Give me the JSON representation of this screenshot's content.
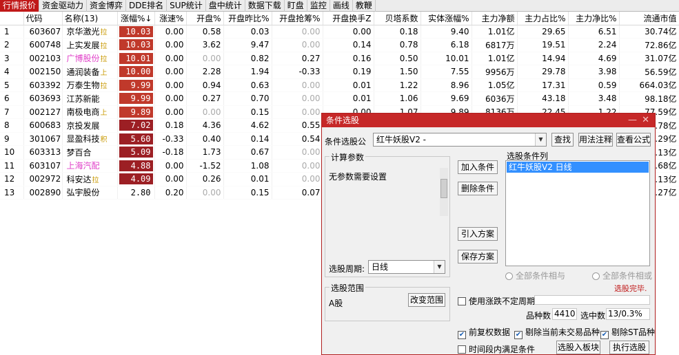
{
  "tabs": [
    "行情报价",
    "资金驱动力",
    "资金博弈",
    "DDE排名",
    "SUP统计",
    "盘中统计",
    "数据下载",
    "盯盘",
    "监控",
    "画线",
    "教鞭"
  ],
  "table": {
    "columns": [
      "",
      "代码",
      "名称(13)",
      "涨幅%↓",
      "涨速%",
      "开盘%",
      "开盘昨比%",
      "开盘抢筹%",
      "开盘换手Z",
      "贝塔系数",
      "实体涨幅%",
      "主力净额",
      "主力占比%",
      "主力净比%",
      "流通市值"
    ],
    "rows": [
      {
        "idx": "1",
        "code": "603607",
        "name": "京华激光",
        "tag": "拉",
        "pct": "10.03",
        "speed": "0.00",
        "open": "0.58",
        "open_prev": "0.03",
        "grab": "0.00",
        "turn": "0.00",
        "beta": "0.18",
        "body": "9.40",
        "net": "1.01亿",
        "occupy": "29.65",
        "netratio": "6.51",
        "cap": "30.74亿"
      },
      {
        "idx": "2",
        "code": "600748",
        "name": "上实发展",
        "tag": "拉",
        "pct": "10.03",
        "speed": "0.00",
        "open": "3.62",
        "open_prev": "9.47",
        "grab": "0.00",
        "turn": "0.14",
        "beta": "0.78",
        "body": "6.18",
        "net": "6817万",
        "occupy": "19.51",
        "netratio": "2.24",
        "cap": "72.86亿"
      },
      {
        "idx": "3",
        "code": "002103",
        "name": "广博股份",
        "tag": "拉",
        "pct": "10.01",
        "speed": "0.00",
        "open": "0.00",
        "open_prev": "0.82",
        "grab": "0.27",
        "turn": "0.16",
        "beta": "0.50",
        "body": "10.01",
        "net": "1.01亿",
        "occupy": "14.94",
        "netratio": "4.69",
        "cap": "31.07亿"
      },
      {
        "idx": "4",
        "code": "002150",
        "name": "通润装备",
        "tag": "上",
        "pct": "10.00",
        "speed": "0.00",
        "open": "2.28",
        "open_prev": "1.94",
        "grab": "-0.33",
        "turn": "0.19",
        "beta": "1.50",
        "body": "7.55",
        "net": "9956万",
        "occupy": "29.78",
        "netratio": "3.98",
        "cap": "56.59亿"
      },
      {
        "idx": "5",
        "code": "603392",
        "name": "万泰生物",
        "tag": "拉",
        "pct": "9.99",
        "speed": "0.00",
        "open": "0.94",
        "open_prev": "0.63",
        "grab": "0.00",
        "turn": "0.01",
        "beta": "1.22",
        "body": "8.96",
        "net": "1.05亿",
        "occupy": "17.31",
        "netratio": "0.59",
        "cap": "664.03亿"
      },
      {
        "idx": "6",
        "code": "603693",
        "name": "江苏新能",
        "tag": "",
        "pct": "9.99",
        "speed": "0.00",
        "open": "0.27",
        "open_prev": "0.70",
        "grab": "0.00",
        "turn": "0.01",
        "beta": "1.06",
        "body": "9.69",
        "net": "6036万",
        "occupy": "43.18",
        "netratio": "3.48",
        "cap": "98.18亿"
      },
      {
        "idx": "7",
        "code": "002127",
        "name": "南极电商",
        "tag": "上",
        "pct": "9.89",
        "speed": "0.00",
        "open": "0.00",
        "open_prev": "0.15",
        "grab": "0.00",
        "turn": "0.00",
        "beta": "1.07",
        "body": "9.89",
        "net": "8136万",
        "occupy": "22.45",
        "netratio": "1.22",
        "cap": "77.59亿"
      },
      {
        "idx": "8",
        "code": "600683",
        "name": "京投发展",
        "tag": "",
        "pct": "7.02",
        "speed": "0.18",
        "open": "4.36",
        "open_prev": "4.62",
        "grab": "0.55",
        "turn": "",
        "beta": "",
        "body": "",
        "net": "",
        "occupy": "",
        "netratio": "",
        "cap": ".78亿"
      },
      {
        "idx": "9",
        "code": "301067",
        "name": "显盈科技",
        "tag": "积",
        "pct": "5.60",
        "speed": "-0.33",
        "open": "0.40",
        "open_prev": "0.14",
        "grab": "0.54",
        "turn": "",
        "beta": "",
        "body": "",
        "net": "",
        "occupy": "",
        "netratio": "",
        "cap": ".29亿"
      },
      {
        "idx": "10",
        "code": "603313",
        "name": "梦百合",
        "tag": "",
        "pct": "5.09",
        "speed": "-0.18",
        "open": "1.73",
        "open_prev": "0.67",
        "grab": "0.00",
        "turn": "",
        "beta": "",
        "body": "",
        "net": "",
        "occupy": "",
        "netratio": "",
        "cap": ".13亿"
      },
      {
        "idx": "11",
        "code": "603107",
        "name": "上海汽配",
        "tag": "",
        "pct": "4.88",
        "speed": "0.00",
        "open": "-1.52",
        "open_prev": "1.08",
        "grab": "0.00",
        "turn": "",
        "beta": "",
        "body": "",
        "net": "",
        "occupy": "",
        "netratio": "",
        "cap": ".68亿"
      },
      {
        "idx": "12",
        "code": "002972",
        "name": "科安达",
        "tag": "拉",
        "pct": "4.09",
        "speed": "0.00",
        "open": "0.26",
        "open_prev": "0.01",
        "grab": "0.00",
        "turn": "",
        "beta": "",
        "body": "",
        "net": "",
        "occupy": "",
        "netratio": "",
        "cap": ".13亿"
      },
      {
        "idx": "13",
        "code": "002890",
        "name": "弘宇股份",
        "tag": "",
        "pct": "2.80",
        "speed": "0.20",
        "open": "0.00",
        "open_prev": "0.15",
        "grab": "0.07",
        "turn": "",
        "beta": "",
        "body": "",
        "net": "",
        "occupy": "",
        "netratio": "",
        "cap": ".27亿"
      }
    ]
  },
  "colors": {
    "accent": "#c01818",
    "pct_dark": "#9c1f24",
    "pct_light": "#c0392b",
    "name_pink": "#e040c8",
    "tag": "#c89800",
    "selection": "#3390ff"
  },
  "dialog": {
    "title": "条件选股",
    "formula_label": "条件选股公",
    "formula_value": "红牛妖股V2  -",
    "find_btn": "查找",
    "usage_btn": "用法注释",
    "view_btn": "查看公式",
    "params_group": "计算参数",
    "params_text": "无参数需要设置",
    "period_label": "选股周期:",
    "period_value": "日线",
    "add_btn": "加入条件",
    "del_btn": "删除条件",
    "import_btn": "引入方案",
    "save_btn": "保存方案",
    "list_title": "选股条件列",
    "list_item": "红牛妖股V2  日线",
    "radio_and": "全部条件相与",
    "radio_or": "全部条件相或",
    "status": "选股完毕.",
    "scope_group": "选股范围",
    "scope_value": "A股",
    "change_scope_btn": "改变范围",
    "use_period_label": "使用涨跌不定周期",
    "count_label": "品种数",
    "count_value": "4410",
    "selected_label": "选中数",
    "selected_value": "13/0.3%",
    "chk_fq": "前复权数据",
    "chk_notrade": "剔除当前未交易品种",
    "chk_st": "剔除ST品种",
    "chk_time": "时间段内满足条件",
    "to_block_btn": "选股入板块",
    "run_btn": "执行选股"
  }
}
